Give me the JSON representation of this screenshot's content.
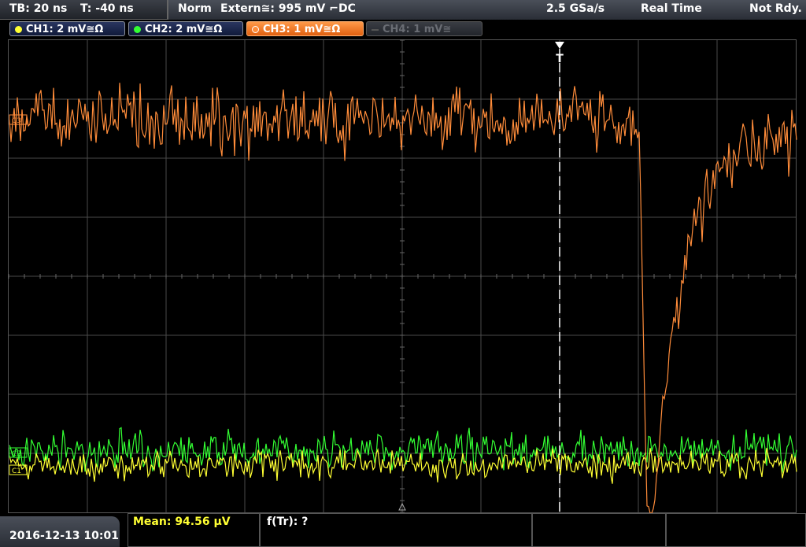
{
  "status": {
    "timebase": "TB: 20 ns",
    "trigger_offset": "T: -40 ns",
    "trigger_mode": "Norm",
    "trigger_source": "Extern≅: 995 mV ⌐DC",
    "sample_rate": "2.5 GSa/s",
    "acq_mode": "Real Time",
    "ready_state": "Not Rdy."
  },
  "channels": [
    {
      "label": "CH1: 2 mV≅Ω",
      "color": "#ffff33",
      "active": false,
      "enabled": true
    },
    {
      "label": "CH2: 2 mV≅Ω",
      "color": "#33ff33",
      "active": false,
      "enabled": true
    },
    {
      "label": "CH3: 1 mV≅Ω",
      "color": "#ff8c3a",
      "active": true,
      "enabled": true
    },
    {
      "label": "CH4: 1 mV≅",
      "color": "#777777",
      "active": false,
      "enabled": false
    }
  ],
  "markers": {
    "trigger": "T",
    "ch3": "C3",
    "ch2": "C2",
    "ch1": "C1"
  },
  "footer": {
    "datetime": "2016-12-13 10:01",
    "mean": "Mean: 94.56 µV",
    "rise_time": "f(Tr): ?"
  },
  "colors": {
    "ch1": "#ffff33",
    "ch2": "#33ff33",
    "ch3": "#ff8c3a",
    "grid": "#4a4a4a"
  }
}
